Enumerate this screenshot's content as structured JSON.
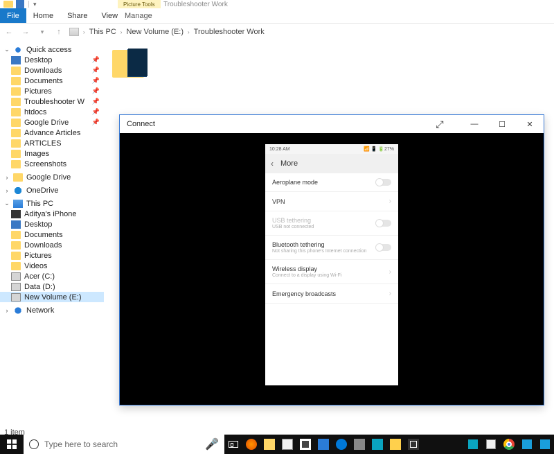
{
  "qat": {
    "dropdown": "▾"
  },
  "ribbon": {
    "file": "File",
    "tabs": [
      "Home",
      "Share",
      "View"
    ],
    "context_group": "Picture Tools",
    "context_tab": "Manage",
    "title": "Troubleshooter Work"
  },
  "addr": {
    "back": "←",
    "fwd": "→",
    "up": "↑",
    "crumbs": [
      "This PC",
      "New Volume (E:)",
      "Troubleshooter Work"
    ],
    "sep": "›"
  },
  "nav": {
    "quick_access": "Quick access",
    "qa_items": [
      {
        "label": "Desktop",
        "pin": true
      },
      {
        "label": "Downloads",
        "pin": true
      },
      {
        "label": "Documents",
        "pin": true
      },
      {
        "label": "Pictures",
        "pin": true
      },
      {
        "label": "Troubleshooter W",
        "pin": true
      },
      {
        "label": "htdocs",
        "pin": true
      },
      {
        "label": "Google Drive",
        "pin": true
      },
      {
        "label": "Advance Articles",
        "pin": false
      },
      {
        "label": "ARTICLES",
        "pin": false
      },
      {
        "label": "Images",
        "pin": false
      },
      {
        "label": "Screenshots",
        "pin": false
      }
    ],
    "google_drive": "Google Drive",
    "onedrive": "OneDrive",
    "this_pc": "This PC",
    "pc_items": [
      {
        "label": "Aditya's iPhone",
        "icon": "ic-phone"
      },
      {
        "label": "Desktop",
        "icon": "ic-desktop"
      },
      {
        "label": "Documents",
        "icon": "ic-folder"
      },
      {
        "label": "Downloads",
        "icon": "ic-folder"
      },
      {
        "label": "Pictures",
        "icon": "ic-folder"
      },
      {
        "label": "Videos",
        "icon": "ic-folder"
      },
      {
        "label": "Acer (C:)",
        "icon": "ic-drive"
      },
      {
        "label": "Data (D:)",
        "icon": "ic-drive"
      },
      {
        "label": "New Volume (E:)",
        "icon": "ic-drive",
        "sel": true
      }
    ],
    "network": "Network"
  },
  "status": {
    "items": "1 item"
  },
  "connect": {
    "title": "Connect",
    "expand": "⤢",
    "min": "—",
    "max": "☐",
    "close": "✕"
  },
  "phone": {
    "time": "10:28 AM",
    "status_icons": "📶 📱 🔋27%",
    "back": "‹",
    "header": "More",
    "items": [
      {
        "label": "Aeroplane mode",
        "ctrl": "toggle"
      },
      {
        "label": "VPN",
        "ctrl": "chev"
      },
      {
        "label": "USB tethering",
        "sub": "USB not connected",
        "ctrl": "toggle",
        "disabled": true
      },
      {
        "label": "Bluetooth tethering",
        "sub": "Not sharing this phone's Internet connection",
        "ctrl": "toggle"
      },
      {
        "label": "Wireless display",
        "sub": "Connect to a display using Wi-Fi",
        "ctrl": "chev"
      },
      {
        "label": "Emergency broadcasts",
        "ctrl": "chev"
      }
    ]
  },
  "taskbar": {
    "search_placeholder": "Type here to search"
  }
}
